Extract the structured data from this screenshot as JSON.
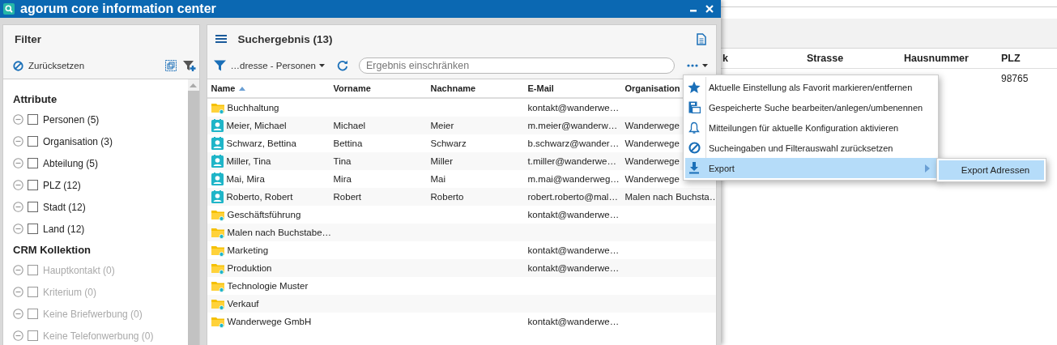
{
  "background_table": {
    "columns": [
      "k",
      "Strasse",
      "Hausnummer",
      "PLZ"
    ],
    "rows": [
      [
        "",
        "",
        "",
        "98765"
      ]
    ]
  },
  "window": {
    "title": "agorum core information center"
  },
  "filter": {
    "title": "Filter",
    "reset_label": "Zurücksetzen",
    "groups": [
      {
        "title": "Attribute",
        "items": [
          {
            "label": "Personen (5)",
            "checked": false,
            "disabled": false
          },
          {
            "label": "Organisation (3)",
            "checked": false,
            "disabled": false
          },
          {
            "label": "Abteilung (5)",
            "checked": false,
            "disabled": false
          },
          {
            "label": "PLZ (12)",
            "checked": false,
            "disabled": false
          },
          {
            "label": "Stadt (12)",
            "checked": false,
            "disabled": false
          },
          {
            "label": "Land (12)",
            "checked": false,
            "disabled": false
          }
        ]
      },
      {
        "title": "CRM Kollektion",
        "items": [
          {
            "label": "Hauptkontakt (0)",
            "checked": false,
            "disabled": true
          },
          {
            "label": "Kriterium (0)",
            "checked": false,
            "disabled": true
          },
          {
            "label": "Keine Briefwerbung (0)",
            "checked": false,
            "disabled": true
          },
          {
            "label": "Keine Telefonwerbung (0)",
            "checked": false,
            "disabled": true
          }
        ]
      }
    ]
  },
  "results": {
    "title": "Suchergebnis (13)",
    "saved_search": "…dresse - Personen",
    "search": {
      "placeholder": "Ergebnis einschränken"
    },
    "columns": [
      {
        "label": "Name",
        "sorted": true
      },
      {
        "label": "Vorname",
        "sorted": false
      },
      {
        "label": "Nachname",
        "sorted": false
      },
      {
        "label": "E-Mail",
        "sorted": false
      },
      {
        "label": "Organisation",
        "sorted": false
      }
    ],
    "rows": [
      {
        "kind": "folder",
        "cells": [
          "Buchhaltung",
          "",
          "",
          "kontakt@wanderwe…",
          ""
        ]
      },
      {
        "kind": "person",
        "cells": [
          "Meier, Michael",
          "Michael",
          "Meier",
          "m.meier@wanderw…",
          "Wanderwege"
        ]
      },
      {
        "kind": "person",
        "cells": [
          "Schwarz, Bettina",
          "Bettina",
          "Schwarz",
          "b.schwarz@wander…",
          "Wanderwege"
        ]
      },
      {
        "kind": "person",
        "cells": [
          "Miller, Tina",
          "Tina",
          "Miller",
          "t.miller@wanderwe…",
          "Wanderwege"
        ]
      },
      {
        "kind": "person",
        "cells": [
          "Mai, Mira",
          "Mira",
          "Mai",
          "m.mai@wanderweg…",
          "Wanderwege"
        ]
      },
      {
        "kind": "person",
        "cells": [
          "Roberto, Robert",
          "Robert",
          "Roberto",
          "robert.roberto@mal…",
          "Malen nach Buchsta…"
        ]
      },
      {
        "kind": "folder",
        "cells": [
          "Geschäftsführung",
          "",
          "",
          "kontakt@wanderwe…",
          ""
        ]
      },
      {
        "kind": "folder",
        "cells": [
          "Malen nach Buchstabe…",
          "",
          "",
          "",
          ""
        ]
      },
      {
        "kind": "folder",
        "cells": [
          "Marketing",
          "",
          "",
          "kontakt@wanderwe…",
          ""
        ]
      },
      {
        "kind": "folder",
        "cells": [
          "Produktion",
          "",
          "",
          "kontakt@wanderwe…",
          ""
        ]
      },
      {
        "kind": "folder",
        "cells": [
          "Technologie Muster",
          "",
          "",
          "",
          ""
        ]
      },
      {
        "kind": "folder",
        "cells": [
          "Verkauf",
          "",
          "",
          "",
          ""
        ]
      },
      {
        "kind": "folder",
        "cells": [
          "Wanderwege GmbH",
          "",
          "",
          "kontakt@wanderwe…",
          ""
        ]
      }
    ]
  },
  "menu": {
    "items": [
      {
        "kind": "star",
        "label": "Aktuelle Einstellung als Favorit markieren/entfernen",
        "selected": false,
        "has_submenu": false
      },
      {
        "kind": "save",
        "label": "Gespeicherte Suche bearbeiten/anlegen/umbenennen",
        "selected": false,
        "has_submenu": false
      },
      {
        "kind": "bell",
        "label": "Mitteilungen für aktuelle Konfiguration aktivieren",
        "selected": false,
        "has_submenu": false
      },
      {
        "kind": "reset",
        "label": "Sucheingaben und Filterauswahl zurücksetzen",
        "selected": false,
        "has_submenu": false
      },
      {
        "kind": "download",
        "label": "Export",
        "selected": true,
        "has_submenu": true
      }
    ],
    "submenu": [
      {
        "label": "Export Adressen",
        "selected": true
      }
    ]
  }
}
